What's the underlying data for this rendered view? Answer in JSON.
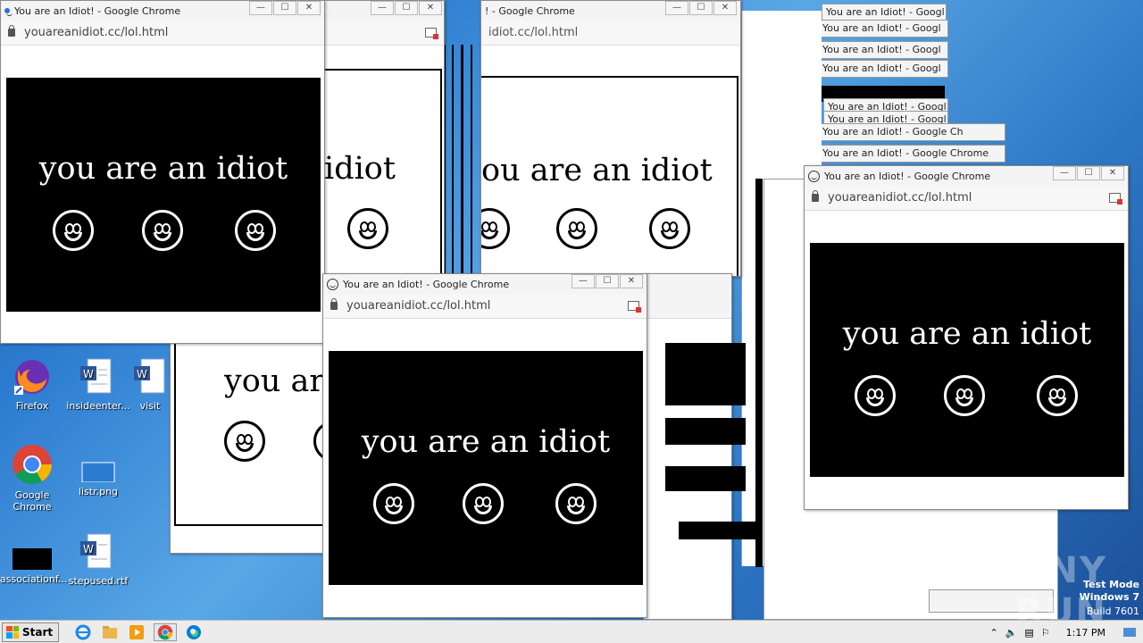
{
  "windows": {
    "title": "You are an Idiot! - Google Chrome",
    "url": "youareanidiot.cc/lol.html",
    "message": "you are an idiot",
    "controls": {
      "minimize": "—",
      "maximize": "☐",
      "close": "✕"
    }
  },
  "partial": {
    "url_mid": "idiot.cc/lol.html",
    "title_mid": "! - Google Chrome",
    "html_frag": "html",
    "rome_frag": "rome",
    "chrome_frag": "hrome",
    "text_frag_idiot": "idiot",
    "text_frag_ou": "ou are an idiot",
    "text_frag_are": "you are",
    "title_trunc_1": "You are an Idiot! - Googl",
    "title_trunc_2": "You are an Idiot! - Google Ch",
    "title_trunc_3": "You are an Idiot! - Google Chrome"
  },
  "desktop": {
    "icons": [
      {
        "label": "Firefox"
      },
      {
        "label": "insideenter..."
      },
      {
        "label": "visit"
      },
      {
        "label": "Google Chrome"
      },
      {
        "label": "listr.png"
      },
      {
        "label": "associationf..."
      },
      {
        "label": "stepused.rtf"
      }
    ]
  },
  "taskbar": {
    "start_label": "Start",
    "clock": "1:17 PM",
    "icons": [
      "ie-icon",
      "explorer-icon",
      "media-player-icon",
      "chrome-icon",
      "edge-icon"
    ]
  },
  "watermark": {
    "line1": "Test Mode",
    "line2": "Windows 7",
    "line3": "Build 7601",
    "anyrun": "ANY RUN"
  }
}
